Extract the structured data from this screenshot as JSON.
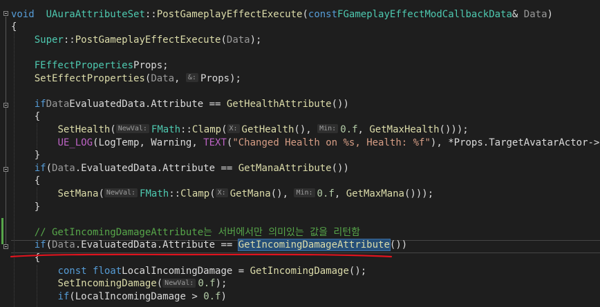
{
  "editor": {
    "lines": [
      {
        "id": "l1",
        "tokens": [
          [
            "kw",
            "void"
          ],
          [
            "",
            "  "
          ],
          [
            "ty",
            "UAuraAttributeSet"
          ],
          [
            "",
            "::"
          ],
          [
            "fn",
            "PostGameplayEffectExecute"
          ],
          [
            "",
            "("
          ],
          [
            "kw",
            "const"
          ],
          [
            "",
            ""
          ],
          [
            "ty",
            "FGameplayEffectModCallbackData"
          ],
          [
            "",
            "& "
          ],
          [
            "par",
            "Data"
          ],
          [
            "",
            ")"
          ]
        ]
      },
      {
        "id": "l2",
        "tokens": [
          [
            "",
            "{"
          ]
        ]
      },
      {
        "id": "l3",
        "tokens": [
          [
            "",
            "    "
          ],
          [
            "ty",
            "Super"
          ],
          [
            "",
            "::"
          ],
          [
            "fn",
            "PostGameplayEffectExecute"
          ],
          [
            "",
            "("
          ],
          [
            "par",
            "Data"
          ],
          [
            "",
            ");"
          ]
        ]
      },
      {
        "id": "l4",
        "tokens": []
      },
      {
        "id": "l5",
        "tokens": [
          [
            "",
            "    "
          ],
          [
            "ty",
            "FEffectProperties"
          ],
          [
            "",
            ""
          ],
          [
            "mem",
            "Props"
          ],
          [
            "",
            ";"
          ]
        ]
      },
      {
        "id": "l6",
        "tokens": [
          [
            "",
            "    "
          ],
          [
            "fn",
            "SetEffectProperties"
          ],
          [
            "",
            "("
          ],
          [
            "par",
            "Data"
          ],
          [
            "",
            ", "
          ],
          [
            "hint",
            "&:"
          ],
          [
            "mem",
            "Props"
          ],
          [
            "",
            ");"
          ]
        ]
      },
      {
        "id": "l7",
        "tokens": []
      },
      {
        "id": "l8",
        "tokens": [
          [
            "",
            "    "
          ],
          [
            "kw",
            "if"
          ],
          [
            "",
            ""
          ],
          [
            "",
            ""
          ],
          [
            "par",
            "Data"
          ],
          [
            ".",
            ""
          ],
          [
            "",
            "EvaluatedData.Attribute == "
          ],
          [
            "fn",
            "GetHealthAttribute"
          ],
          [
            "",
            "())"
          ]
        ]
      },
      {
        "id": "l9",
        "tokens": [
          [
            "",
            "    {"
          ]
        ]
      },
      {
        "id": "l10",
        "tokens": [
          [
            "",
            "        "
          ],
          [
            "fn",
            "SetHealth"
          ],
          [
            "",
            "("
          ],
          [
            "hint",
            "NewVal:"
          ],
          [
            "ty",
            "FMath"
          ],
          [
            "",
            "::"
          ],
          [
            "fn",
            "Clamp"
          ],
          [
            "",
            "("
          ],
          [
            "hint",
            "X:"
          ],
          [
            "fn",
            "GetHealth"
          ],
          [
            "",
            "(), "
          ],
          [
            "hint",
            "Min:"
          ],
          [
            "num",
            "0.f"
          ],
          [
            "",
            ", "
          ],
          [
            "fn",
            "GetMaxHealth"
          ],
          [
            "",
            "()));"
          ]
        ]
      },
      {
        "id": "l11",
        "tokens": [
          [
            "",
            "        "
          ],
          [
            "mac",
            "UE_LOG"
          ],
          [
            "",
            "("
          ],
          [
            "",
            ""
          ],
          [
            "",
            "LogTemp, Warning, "
          ],
          [
            "mac",
            "TEXT"
          ],
          [
            "",
            "("
          ],
          [
            "str",
            "\"Changed Health on %s, Health: %f\""
          ],
          [
            "",
            "), *"
          ],
          [
            "mem",
            "Props"
          ],
          [
            "",
            ".TargetAvatarActor->GetN"
          ]
        ]
      },
      {
        "id": "l12",
        "tokens": [
          [
            "",
            "    }"
          ]
        ]
      },
      {
        "id": "l13",
        "tokens": [
          [
            "",
            "    "
          ],
          [
            "kw",
            "if"
          ],
          [
            "",
            "("
          ],
          [
            "par",
            "Data"
          ],
          [
            "",
            ".EvaluatedData.Attribute == "
          ],
          [
            "fn",
            "GetManaAttribute"
          ],
          [
            "",
            "())"
          ]
        ]
      },
      {
        "id": "l14",
        "tokens": [
          [
            "",
            "    {"
          ]
        ]
      },
      {
        "id": "l15",
        "tokens": [
          [
            "",
            "        "
          ],
          [
            "fn",
            "SetMana"
          ],
          [
            "",
            "("
          ],
          [
            "hint",
            "NewVal:"
          ],
          [
            "ty",
            "FMath"
          ],
          [
            "",
            "::"
          ],
          [
            "fn",
            "Clamp"
          ],
          [
            "",
            "("
          ],
          [
            "hint",
            "X:"
          ],
          [
            "fn",
            "GetMana"
          ],
          [
            "",
            "(), "
          ],
          [
            "hint",
            "Min:"
          ],
          [
            "num",
            "0.f"
          ],
          [
            "",
            ", "
          ],
          [
            "fn",
            "GetMaxMana"
          ],
          [
            "",
            "()));"
          ]
        ]
      },
      {
        "id": "l16",
        "tokens": [
          [
            "",
            "    }"
          ]
        ]
      },
      {
        "id": "l17",
        "tokens": []
      },
      {
        "id": "l18",
        "tokens": [
          [
            "",
            "    "
          ],
          [
            "cmt",
            "// GetIncomingDamageAttribute는 서버에서만 의미있는 값을 리턴함"
          ]
        ]
      },
      {
        "id": "l19",
        "tokens": [
          [
            "",
            "    "
          ],
          [
            "kw",
            "if"
          ],
          [
            "",
            "("
          ],
          [
            "par",
            "Data"
          ],
          [
            "",
            ".EvaluatedData.Attribute == "
          ],
          [
            "fn sel",
            "GetIncomingDamageAttribute"
          ],
          [
            "",
            "())"
          ]
        ]
      },
      {
        "id": "l20",
        "tokens": [
          [
            "",
            "    {"
          ]
        ]
      },
      {
        "id": "l21",
        "tokens": [
          [
            "",
            "        "
          ],
          [
            "kw",
            "const float"
          ],
          [
            "",
            ""
          ],
          [
            "mem",
            "LocalIncomingDamage"
          ],
          [
            "",
            " = "
          ],
          [
            "fn",
            "GetIncomingDamage"
          ],
          [
            "",
            "();"
          ]
        ]
      },
      {
        "id": "l22",
        "tokens": [
          [
            "",
            "        "
          ],
          [
            "fn",
            "SetIncomingDamage"
          ],
          [
            "",
            "("
          ],
          [
            "hint",
            "NewVal:"
          ],
          [
            "num",
            "0.f"
          ],
          [
            "",
            ");"
          ]
        ]
      },
      {
        "id": "l23",
        "tokens": [
          [
            "",
            "        "
          ],
          [
            "kw",
            "if"
          ],
          [
            "",
            "("
          ],
          [
            "mem",
            "LocalIncomingDamage"
          ],
          [
            "",
            " > "
          ],
          [
            "num",
            "0.f"
          ],
          [
            "",
            ")"
          ]
        ]
      }
    ]
  },
  "colors": {
    "background": "#1e1e1e",
    "keyword": "#569cd6",
    "type": "#4ec9b0",
    "function": "#dcdcaa",
    "string": "#d69d85",
    "comment": "#57a64a",
    "parameter": "#9a9a9a",
    "macro": "#bd63c5",
    "annotation": "#e0141e",
    "selection": "#264f78"
  },
  "icons": {
    "fold": "collapse-box-icon",
    "annotation": "red-underline-mark"
  }
}
